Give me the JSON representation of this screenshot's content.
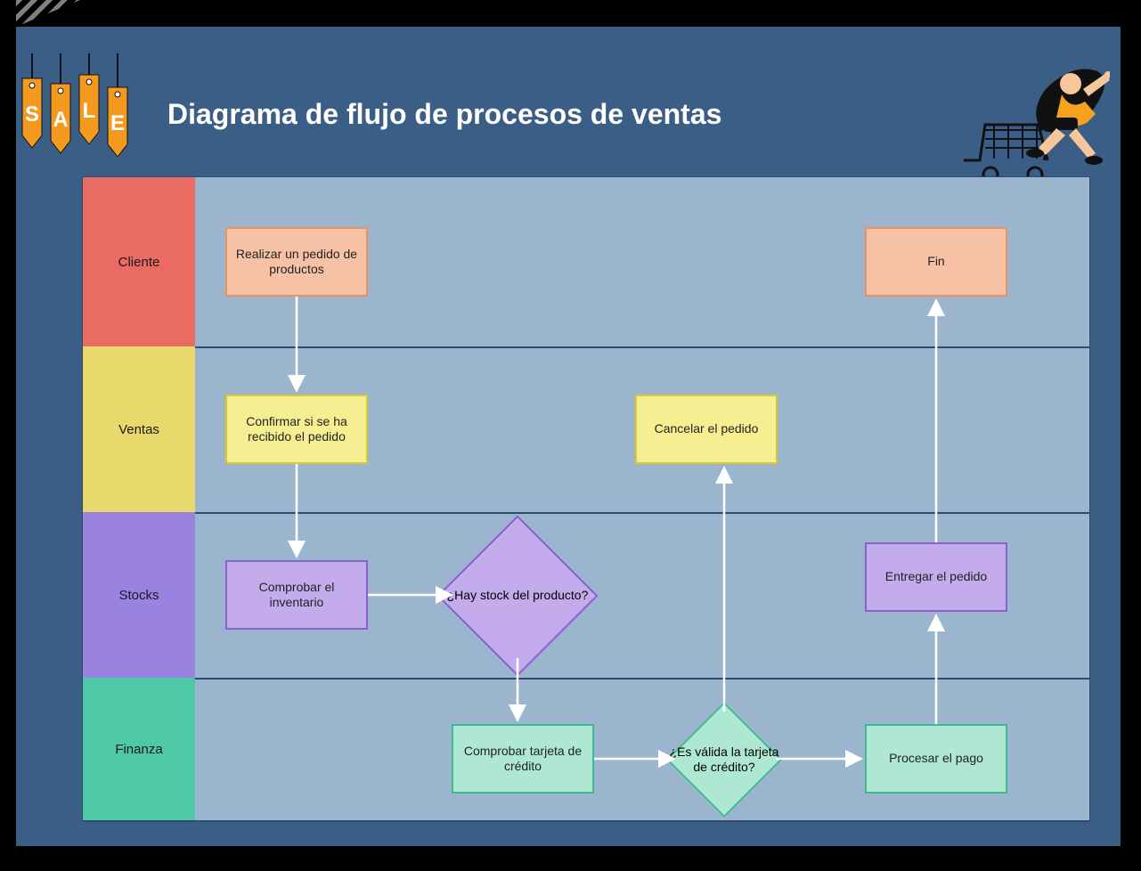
{
  "title": "Diagrama de flujo de procesos de ventas",
  "lanes": {
    "cliente": "Cliente",
    "ventas": "Ventas",
    "stocks": "Stocks",
    "finanza": "Finanza"
  },
  "nodes": {
    "realizar": "Realizar un pedido de productos",
    "fin": "Fin",
    "confirmar": "Confirmar si se ha recibido el pedido",
    "cancelar": "Cancelar el pedido",
    "comprobar_inv": "Comprobar el inventario",
    "hay_stock": "¿Hay stock del producto?",
    "entregar": "Entregar el pedido",
    "comprobar_cc": "Comprobar tarjeta de crédito",
    "valida_cc": "¿Es válida la tarjeta de crédito?",
    "procesar": "Procesar el pago"
  },
  "sale_letters": [
    "S",
    "A",
    "L",
    "E"
  ],
  "diagram": {
    "type": "swimlane-flowchart",
    "swimlanes": [
      "Cliente",
      "Ventas",
      "Stocks",
      "Finanza"
    ],
    "shapes": [
      {
        "id": "realizar",
        "lane": "Cliente",
        "shape": "process",
        "text": "Realizar un pedido de productos"
      },
      {
        "id": "fin",
        "lane": "Cliente",
        "shape": "process",
        "text": "Fin"
      },
      {
        "id": "confirmar",
        "lane": "Ventas",
        "shape": "process",
        "text": "Confirmar si se ha recibido el pedido"
      },
      {
        "id": "cancelar",
        "lane": "Ventas",
        "shape": "process",
        "text": "Cancelar el pedido"
      },
      {
        "id": "comprobar_inv",
        "lane": "Stocks",
        "shape": "process",
        "text": "Comprobar el inventario"
      },
      {
        "id": "hay_stock",
        "lane": "Stocks",
        "shape": "decision",
        "text": "¿Hay stock del producto?"
      },
      {
        "id": "entregar",
        "lane": "Stocks",
        "shape": "process",
        "text": "Entregar el pedido"
      },
      {
        "id": "comprobar_cc",
        "lane": "Finanza",
        "shape": "process",
        "text": "Comprobar tarjeta de crédito"
      },
      {
        "id": "valida_cc",
        "lane": "Finanza",
        "shape": "decision",
        "text": "¿Es válida la tarjeta de crédito?"
      },
      {
        "id": "procesar",
        "lane": "Finanza",
        "shape": "process",
        "text": "Procesar el pago"
      }
    ],
    "edges": [
      {
        "from": "realizar",
        "to": "confirmar"
      },
      {
        "from": "confirmar",
        "to": "comprobar_inv"
      },
      {
        "from": "comprobar_inv",
        "to": "hay_stock"
      },
      {
        "from": "hay_stock",
        "to": "comprobar_cc"
      },
      {
        "from": "comprobar_cc",
        "to": "valida_cc"
      },
      {
        "from": "valida_cc",
        "to": "cancelar"
      },
      {
        "from": "valida_cc",
        "to": "procesar"
      },
      {
        "from": "procesar",
        "to": "entregar"
      },
      {
        "from": "entregar",
        "to": "fin"
      }
    ]
  }
}
